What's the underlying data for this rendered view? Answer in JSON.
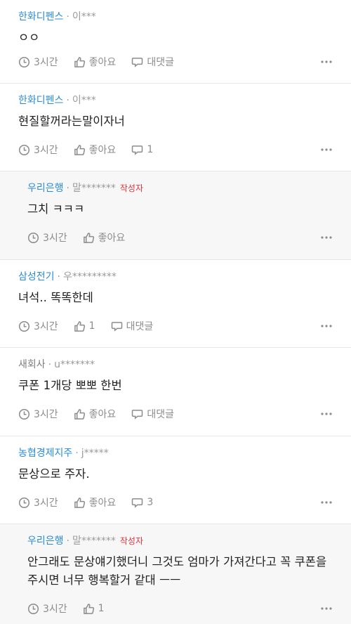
{
  "comments": [
    {
      "company": "한화디펜스",
      "user": "이***",
      "author_tag": "",
      "text": "ㅇㅇ",
      "time": "3시간",
      "like": "좋아요",
      "reply": "대댓글"
    },
    {
      "company": "한화디펜스",
      "user": "이***",
      "author_tag": "",
      "text": "현질할꺼라는말이자너",
      "time": "3시간",
      "like": "좋아요",
      "reply": "1"
    },
    {
      "company": "우리은행",
      "user": "말*******",
      "author_tag": "작성자",
      "text": "그치 ㅋㅋㅋ",
      "time": "3시간",
      "like": "좋아요",
      "reply": ""
    },
    {
      "company": "삼성전기",
      "user": "우*********",
      "author_tag": "",
      "text": "녀석.. 똑똑한데",
      "time": "3시간",
      "like": "1",
      "reply": "대댓글"
    },
    {
      "company": "새회사",
      "user": "u*******",
      "author_tag": "",
      "text": "쿠폰 1개당 뽀뽀 한번",
      "time": "3시간",
      "like": "좋아요",
      "reply": "대댓글"
    },
    {
      "company": "농협경제지주",
      "user": "j*****",
      "author_tag": "",
      "text": "문상으로 주자.",
      "time": "3시간",
      "like": "좋아요",
      "reply": "3"
    },
    {
      "company": "우리은행",
      "user": "말*******",
      "author_tag": "작성자",
      "text": "안그래도 문상얘기했더니 그것도 엄마가 가져간다고 꼭 쿠폰을 주시면 너무 행복할거 같대 ㅡㅡ",
      "time": "3시간",
      "like": "1",
      "reply": ""
    }
  ],
  "separator": "·",
  "colors": {
    "company": "#2a8bd8",
    "company_plain": "#7c7c7c",
    "author_tag": "#e0323a",
    "reply_bg": "#f7f7f7"
  },
  "icons": {
    "time": "clock-icon",
    "like": "thumbs-up-icon",
    "reply": "speech-bubble-icon",
    "more": "more-dots-icon"
  }
}
